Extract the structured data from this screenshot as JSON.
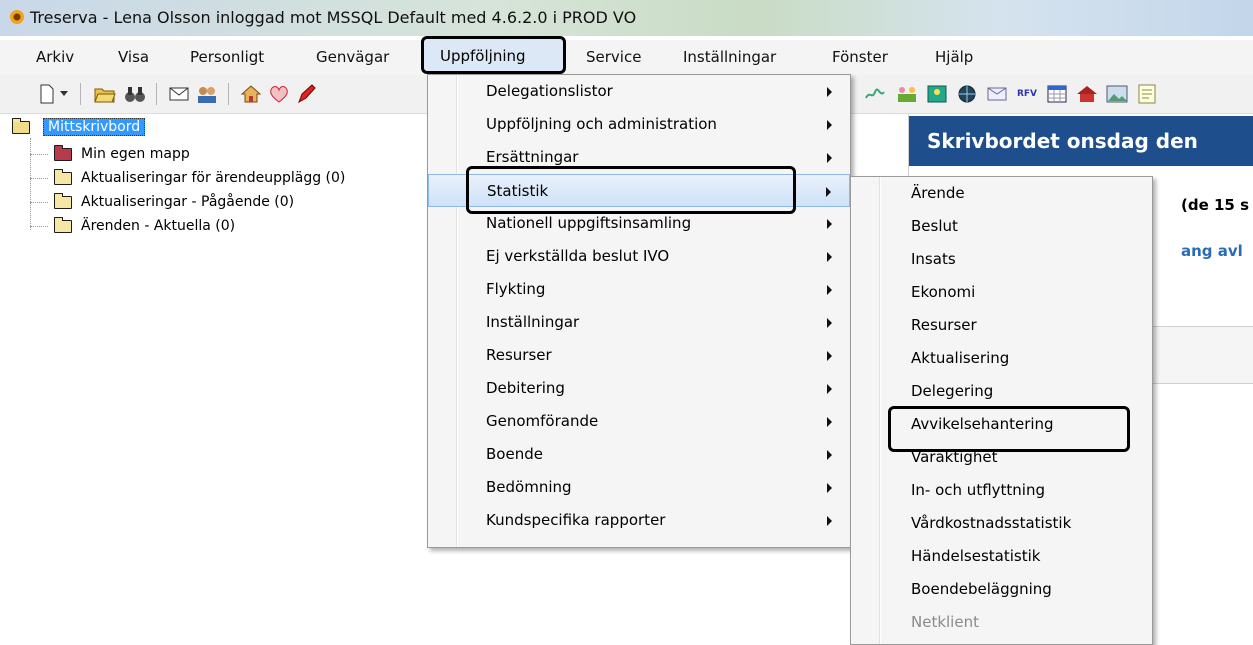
{
  "window": {
    "title": "Treserva - Lena Olsson inloggad mot MSSQL Default  med 4.6.2.0 i PROD VO"
  },
  "menubar": [
    {
      "label": "Arkiv"
    },
    {
      "label": "Visa"
    },
    {
      "label": "Personligt"
    },
    {
      "label": "Genvägar"
    },
    {
      "label": "Uppföljning"
    },
    {
      "label": "Service"
    },
    {
      "label": "Inställningar"
    },
    {
      "label": "Fönster"
    },
    {
      "label": "Hjälp"
    }
  ],
  "toolbar_icons": [
    "new-document-icon",
    "dropdown-arrow-icon",
    "open-folder-icon",
    "binoculars-icon",
    "mail-icon",
    "people-icon",
    "home-icon",
    "heart-icon",
    "pen-icon",
    "signature-icon",
    "group-icon",
    "grid-person-icon",
    "globe-icon",
    "envelope-icon",
    "rfv-icon",
    "calendar-icon",
    "house-icon",
    "image-icon",
    "notes-icon"
  ],
  "toolbar": {
    "rfv_label": "RFV"
  },
  "tree": {
    "root": "Mittskrivbord",
    "items": [
      {
        "label": "Min egen mapp",
        "color": "#b93a4a"
      },
      {
        "label": "Aktualiseringar för ärendeupplägg (0)",
        "color": "#f6e7a4"
      },
      {
        "label": "Aktualiseringar - Pågående (0)",
        "color": "#f6e7a4"
      },
      {
        "label": "Ärenden - Aktuella (0)",
        "color": "#f6e7a4"
      }
    ]
  },
  "right_panel": {
    "header": "Skrivbordet onsdag den",
    "line1": "(de 15 s",
    "line2": "ang avl"
  },
  "uppfoljning_menu": [
    {
      "label": "Delegationslistor",
      "has_submenu": true
    },
    {
      "label": "Uppföljning och administration",
      "has_submenu": true
    },
    {
      "label": "Ersättningar",
      "has_submenu": true
    },
    {
      "label": "Statistik",
      "has_submenu": true,
      "highlighted": true
    },
    {
      "label": "Nationell uppgiftsinsamling",
      "has_submenu": true
    },
    {
      "label": "Ej verkställda beslut IVO",
      "has_submenu": true
    },
    {
      "label": "Flykting",
      "has_submenu": true
    },
    {
      "label": "Inställningar",
      "has_submenu": true
    },
    {
      "label": "Resurser",
      "has_submenu": true
    },
    {
      "label": "Debitering",
      "has_submenu": true
    },
    {
      "label": "Genomförande",
      "has_submenu": true
    },
    {
      "label": "Boende",
      "has_submenu": true
    },
    {
      "label": "Bedömning",
      "has_submenu": true
    },
    {
      "label": "Kundspecifika rapporter",
      "has_submenu": true
    }
  ],
  "statistik_submenu": [
    {
      "label": "Ärende"
    },
    {
      "label": "Beslut"
    },
    {
      "label": "Insats"
    },
    {
      "label": "Ekonomi"
    },
    {
      "label": "Resurser"
    },
    {
      "label": "Aktualisering"
    },
    {
      "label": "Delegering"
    },
    {
      "label": "Avvikelsehantering",
      "outlined": true
    },
    {
      "label": "Varaktighet"
    },
    {
      "label": "In- och utflyttning"
    },
    {
      "label": "Vårdkostnadsstatistik"
    },
    {
      "label": "Händelsestatistik"
    },
    {
      "label": "Boendebeläggning"
    },
    {
      "label": "Netklient",
      "disabled": true
    }
  ],
  "colors": {
    "accent": "#1f4e8c",
    "selection": "#3399ff",
    "link": "#2a6bb4"
  }
}
